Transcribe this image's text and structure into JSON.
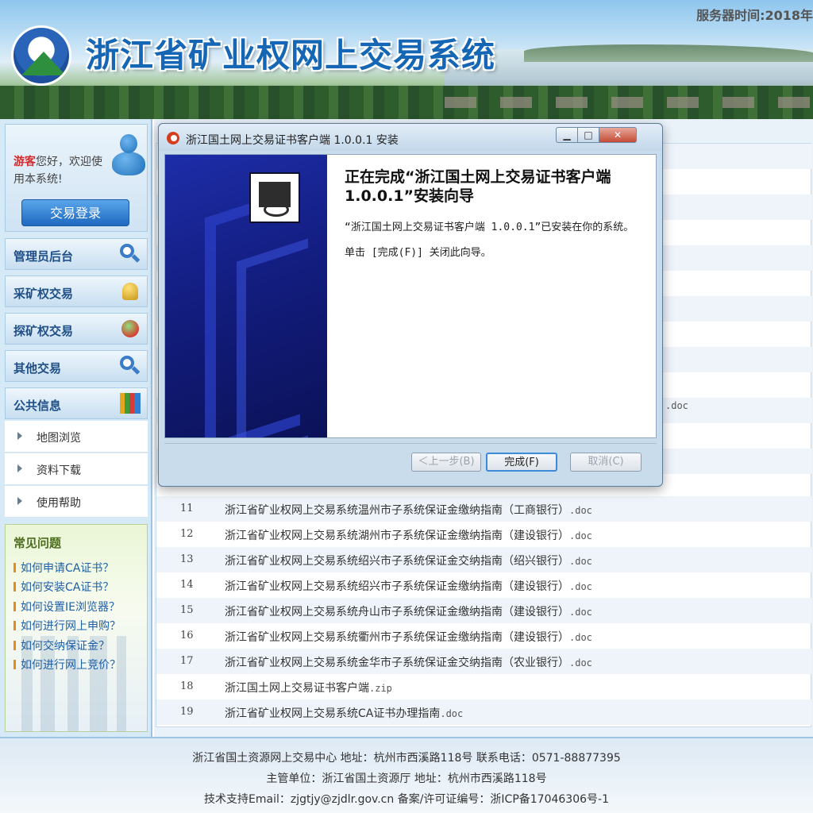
{
  "header": {
    "site_title": "浙江省矿业权网上交易系统",
    "server_time": "服务器时间:2018年"
  },
  "sidebar": {
    "greeting_guest": "游客",
    "greeting_rest": "您好，欢迎使用本系统!",
    "login_button": "交易登录",
    "nav": [
      {
        "label": "管理员后台",
        "icon": "magnifier-icon"
      },
      {
        "label": "采矿权交易",
        "icon": "bell-icon"
      },
      {
        "label": "探矿权交易",
        "icon": "gear-icon"
      },
      {
        "label": "其他交易",
        "icon": "magnifier-icon"
      },
      {
        "label": "公共信息",
        "icon": "books-icon"
      }
    ],
    "sub_items": [
      "地图浏览",
      "资料下载",
      "使用帮助"
    ],
    "faq_title": "常见问题",
    "faq": [
      "如何申请CA证书？",
      "如何安装CA证书？",
      "如何设置IE浏览器？",
      "如何进行网上申购？",
      "如何交纳保证金？",
      "如何进行网上竞价？"
    ]
  },
  "main": {
    "partial_row_ext": "）.doc",
    "rows": [
      {
        "num": "11",
        "name": "浙江省矿业权网上交易系统温州市子系统保证金缴纳指南（工商银行）",
        "ext": ".doc"
      },
      {
        "num": "12",
        "name": "浙江省矿业权网上交易系统湖州市子系统保证金缴纳指南（建设银行）",
        "ext": ".doc"
      },
      {
        "num": "13",
        "name": "浙江省矿业权网上交易系统绍兴市子系统保证金交纳指南（绍兴银行）",
        "ext": ".doc"
      },
      {
        "num": "14",
        "name": "浙江省矿业权网上交易系统绍兴市子系统保证金缴纳指南（建设银行）",
        "ext": ".doc"
      },
      {
        "num": "15",
        "name": "浙江省矿业权网上交易系统舟山市子系统保证金缴纳指南（建设银行）",
        "ext": ".doc"
      },
      {
        "num": "16",
        "name": "浙江省矿业权网上交易系统衢州市子系统保证金缴纳指南（建设银行）",
        "ext": ".doc"
      },
      {
        "num": "17",
        "name": "浙江省矿业权网上交易系统金华市子系统保证金交纳指南（农业银行）",
        "ext": ".doc"
      },
      {
        "num": "18",
        "name": "浙江国土网上交易证书客户端",
        "ext": ".zip"
      },
      {
        "num": "19",
        "name": "浙江省矿业权网上交易系统CA证书办理指南",
        "ext": ".doc"
      }
    ]
  },
  "footer": {
    "line1": "浙江省国土资源网上交易中心  地址：杭州市西溪路118号   联系电话：0571-88877395",
    "line2": "主管单位：浙江省国土资源厅 地址：杭州市西溪路118号",
    "line3": "技术支持Email：zjgtjy@zjdlr.gov.cn   备案/许可证编号：浙ICP备17046306号-1"
  },
  "dialog": {
    "title": "浙江国土网上交易证书客户端 1.0.0.1 安装",
    "heading": "正在完成“浙江国土网上交易证书客户端 1.0.0.1”安装向导",
    "text1": "“浙江国土网上交易证书客户端 1.0.0.1”已安装在你的系统。",
    "text2": "单击 [完成(F)] 关闭此向导。",
    "btn_back": "＜上一步(B)",
    "btn_finish": "完成(F)",
    "btn_cancel": "取消(C)"
  },
  "colors": {
    "brand_blue": "#1566b4",
    "guest_red": "#d22b2b",
    "faq_link": "#1d5fa8",
    "wizard_side": "#121c7c"
  }
}
